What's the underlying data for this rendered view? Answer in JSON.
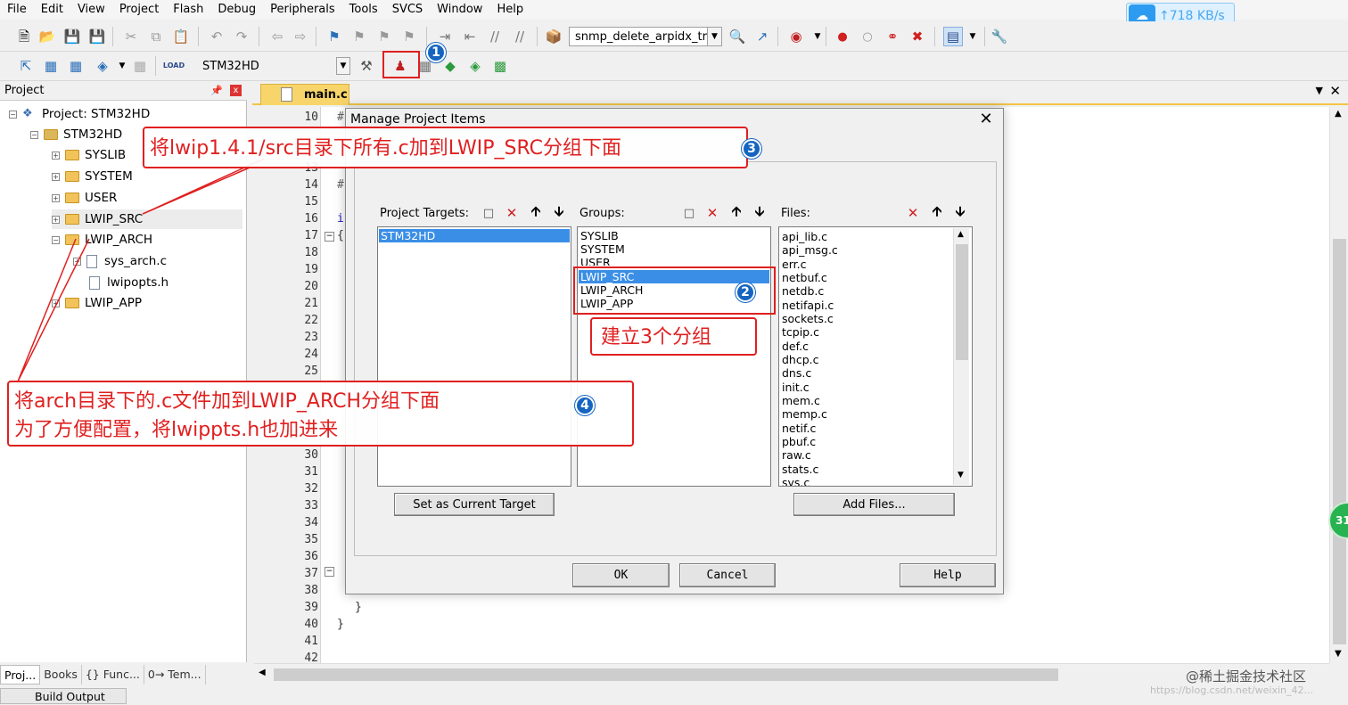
{
  "menu": [
    "File",
    "Edit",
    "View",
    "Project",
    "Flash",
    "Debug",
    "Peripherals",
    "Tools",
    "SVCS",
    "Window",
    "Help"
  ],
  "toolbar": {
    "function_combo": "snmp_delete_arpidx_tree",
    "target_combo": "STM32HD",
    "load_label": "LOAD"
  },
  "speed_widget": {
    "value": "↑718 KB/s"
  },
  "project_panel": {
    "title": "Project",
    "pin": "Ȩ",
    "close": "x",
    "tree": {
      "root": "Project: STM32HD",
      "target": "STM32HD",
      "groups": [
        "SYSLIB",
        "SYSTEM",
        "USER",
        "LWIP_SRC",
        "LWIP_ARCH",
        "LWIP_APP"
      ],
      "arch_files": [
        "sys_arch.c",
        "lwipopts.h"
      ]
    },
    "tabs": [
      "Proj...",
      "Books",
      "{} Func...",
      "0→ Tem..."
    ],
    "build_output": "Build Output"
  },
  "editor": {
    "tab": "main.c",
    "line_numbers": [
      "10",
      "",
      "",
      "13",
      "14",
      "15",
      "16",
      "17",
      "18",
      "19",
      "20",
      "21",
      "22",
      "23",
      "24",
      "25",
      "",
      "",
      "",
      "",
      "30",
      "31",
      "32",
      "33",
      "34",
      "35",
      "36",
      "37",
      "38",
      "39",
      "40",
      "41",
      "42"
    ],
    "code_fragments": {
      "l10": "#",
      "l14": "#",
      "l16": "i",
      "l17": "{",
      "l39": "}",
      "l40": "}"
    }
  },
  "dialog": {
    "title": "Manage Project Items",
    "close": "✕",
    "targets": {
      "header": "Project Targets:",
      "items": [
        "STM32HD"
      ]
    },
    "groups": {
      "header": "Groups:",
      "items": [
        "SYSLIB",
        "SYSTEM",
        "USER",
        "LWIP_SRC",
        "LWIP_ARCH",
        "LWIP_APP"
      ],
      "selected": "LWIP_SRC"
    },
    "files": {
      "header": "Files:",
      "items": [
        "api_lib.c",
        "api_msg.c",
        "err.c",
        "netbuf.c",
        "netdb.c",
        "netifapi.c",
        "sockets.c",
        "tcpip.c",
        "def.c",
        "dhcp.c",
        "dns.c",
        "init.c",
        "mem.c",
        "memp.c",
        "netif.c",
        "pbuf.c",
        "raw.c",
        "stats.c",
        "sys.c"
      ]
    },
    "buttons": {
      "set_current_target": "Set as Current Target",
      "add_files": "Add Files...",
      "ok": "OK",
      "cancel": "Cancel",
      "help": "Help"
    }
  },
  "annotations": {
    "badge1": "1",
    "badge2": "2",
    "badge3": "3",
    "badge4": "4",
    "note_src": "将lwip1.4.1/src目录下所有.c加到LWIP_SRC分组下面",
    "note_groups": "建立3个分组",
    "note_arch_line1": "将arch目录下的.c文件加到LWIP_ARCH分组下面",
    "note_arch_line2": "为了方便配置，将lwippts.h也加进来"
  },
  "side_badge": "31",
  "watermark": "@稀土掘金技术社区",
  "watermark_faint": "https://blog.csdn.net/weixin_42..."
}
